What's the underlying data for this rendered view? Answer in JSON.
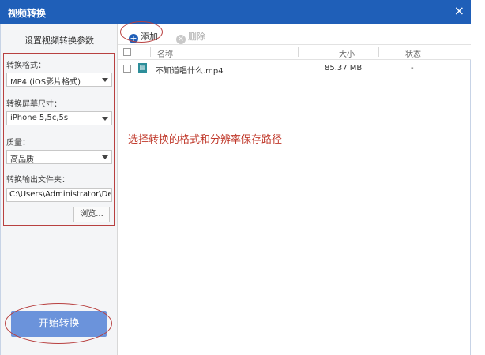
{
  "window": {
    "title": "视频转换",
    "close_glyph": "×"
  },
  "sidebar": {
    "title": "设置视频转换参数",
    "format_label": "转换格式：",
    "format_value": "MP4 (iOS影片格式)",
    "size_label": "转换屏幕尺寸：",
    "size_value": "iPhone 5,5c,5s",
    "quality_label": "质量：",
    "quality_value": "高品质",
    "output_label": "转换输出文件夹：",
    "output_path": "C:\\Users\\Administrator\\Deskto",
    "browse_label": "浏览...",
    "start_label": "开始转换"
  },
  "toolbar": {
    "add_label": "添加",
    "delete_label": "删除"
  },
  "table": {
    "columns": [
      "名称",
      "大小",
      "状态"
    ],
    "rows": [
      {
        "name": "不知道唱什么.mp4",
        "size": "85.37 MB",
        "status": "-"
      }
    ]
  },
  "annotation": "选择转换的格式和分辨率保存路径",
  "colors": {
    "titlebar": "#1f5fb8",
    "start_button": "#6b93db",
    "annotation": "#c0392b"
  }
}
